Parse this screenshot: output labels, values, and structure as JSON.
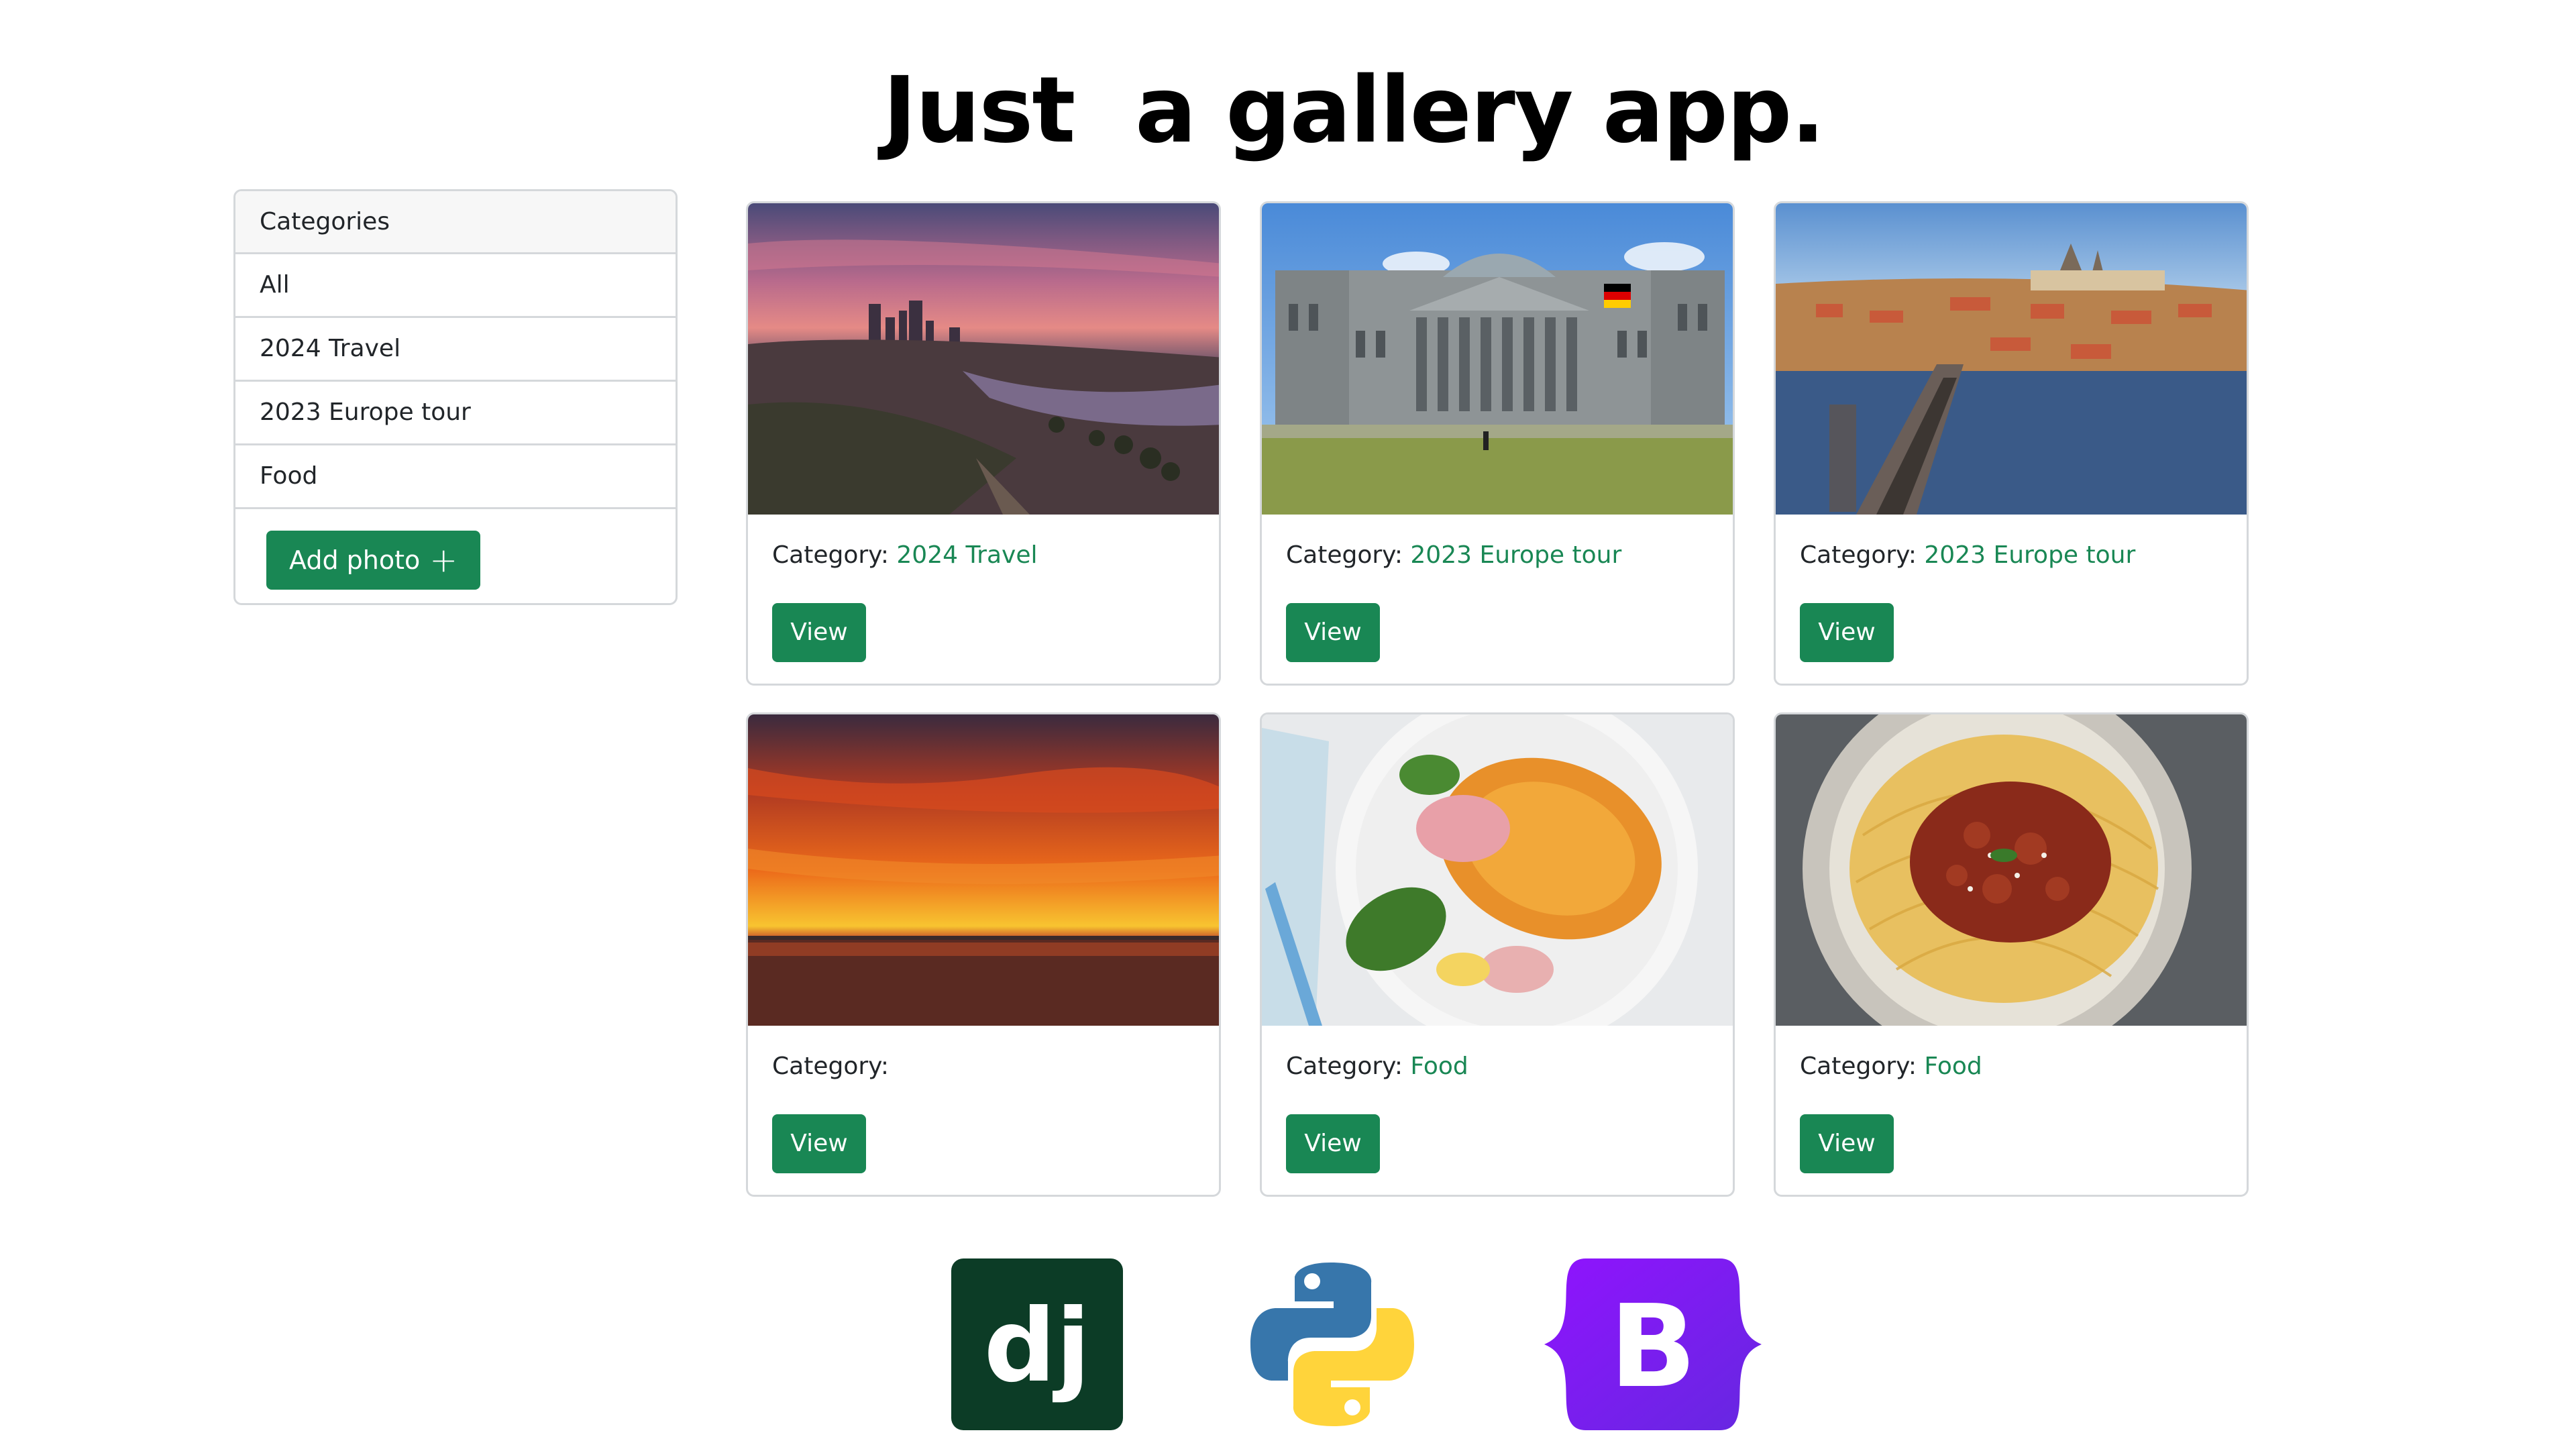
{
  "headline": "Just  a gallery app.",
  "sidebar": {
    "header": "Categories",
    "items": [
      {
        "label": "All"
      },
      {
        "label": "2024 Travel"
      },
      {
        "label": "2023 Europe tour"
      },
      {
        "label": "Food"
      }
    ],
    "add_button": {
      "label": "Add photo",
      "icon": "plus-icon"
    }
  },
  "cards": [
    {
      "category_label": "Category:",
      "category": "2024 Travel",
      "button": "View",
      "image": "city-sunset-photo"
    },
    {
      "category_label": "Category:",
      "category": "2023 Europe tour",
      "button": "View",
      "image": "reichstag-photo"
    },
    {
      "category_label": "Category:",
      "category": "2023 Europe tour",
      "button": "View",
      "image": "prague-bridge-photo"
    },
    {
      "category_label": "Category:",
      "category": "",
      "button": "View",
      "image": "ocean-sunset-photo"
    },
    {
      "category_label": "Category:",
      "category": "Food",
      "button": "View",
      "image": "croissant-photo"
    },
    {
      "category_label": "Category:",
      "category": "Food",
      "button": "View",
      "image": "spaghetti-photo"
    }
  ],
  "logos": [
    {
      "name": "django-logo",
      "text": "dj",
      "color": "#0c3c26"
    },
    {
      "name": "python-logo",
      "colors": [
        "#3776ab",
        "#ffd43b"
      ]
    },
    {
      "name": "bootstrap-logo",
      "text": "B",
      "color": "#7952b3"
    }
  ],
  "colors": {
    "accent": "#198754",
    "border": "#d5d8db"
  }
}
